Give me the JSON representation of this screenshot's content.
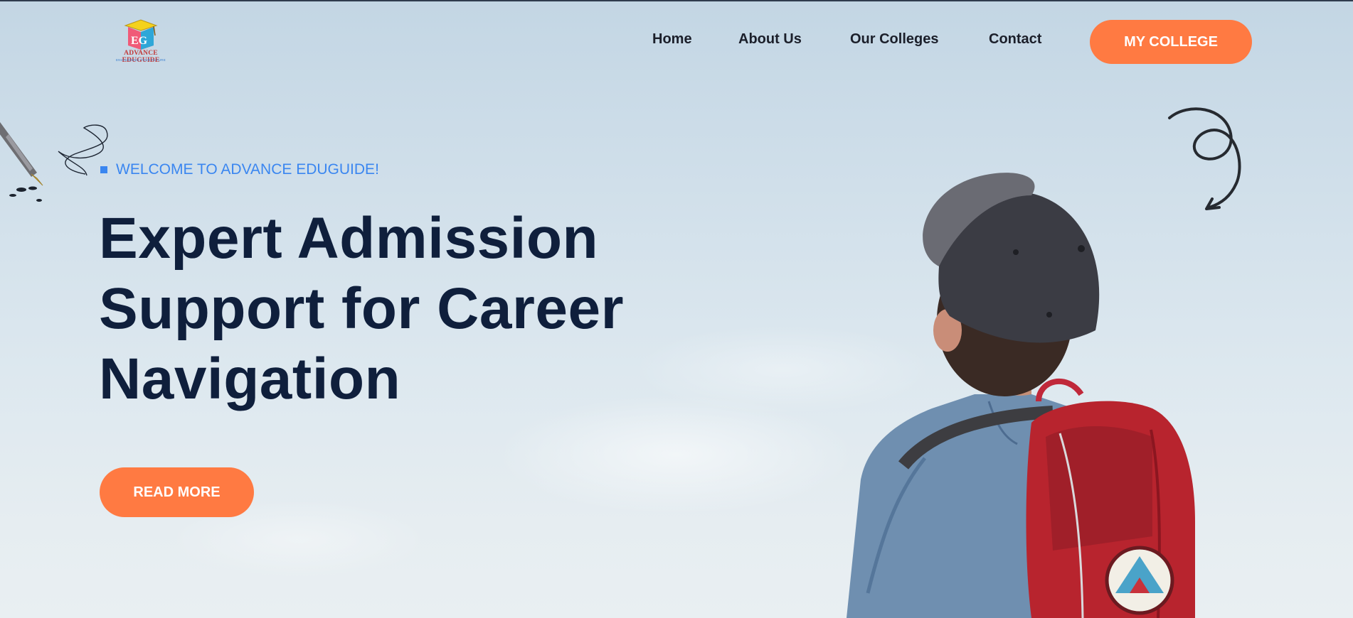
{
  "header": {
    "logo": {
      "name": "ADVANCE EDUGUIDE",
      "tagline": "ENVISIONING YOUR FUTURE",
      "mark": "EG"
    },
    "nav": [
      {
        "label": "Home"
      },
      {
        "label": "About Us"
      },
      {
        "label": "Our Colleges"
      },
      {
        "label": "Contact"
      }
    ],
    "cta_label": "MY COLLEGE"
  },
  "hero": {
    "eyebrow": "WELCOME TO ADVANCE EDUGUIDE!",
    "headline_lines": [
      "Expert Admission",
      "Support for Career",
      "Navigation"
    ],
    "button_label": "READ MORE"
  },
  "colors": {
    "accent": "#ff7a42",
    "eyebrow": "#3a86f0",
    "headline": "#0f1f3c",
    "nav_text": "#1b1f2a"
  },
  "icons": [
    "fountain-pen-icon",
    "curly-arrow-icon",
    "logo-mortarboard-icon"
  ]
}
